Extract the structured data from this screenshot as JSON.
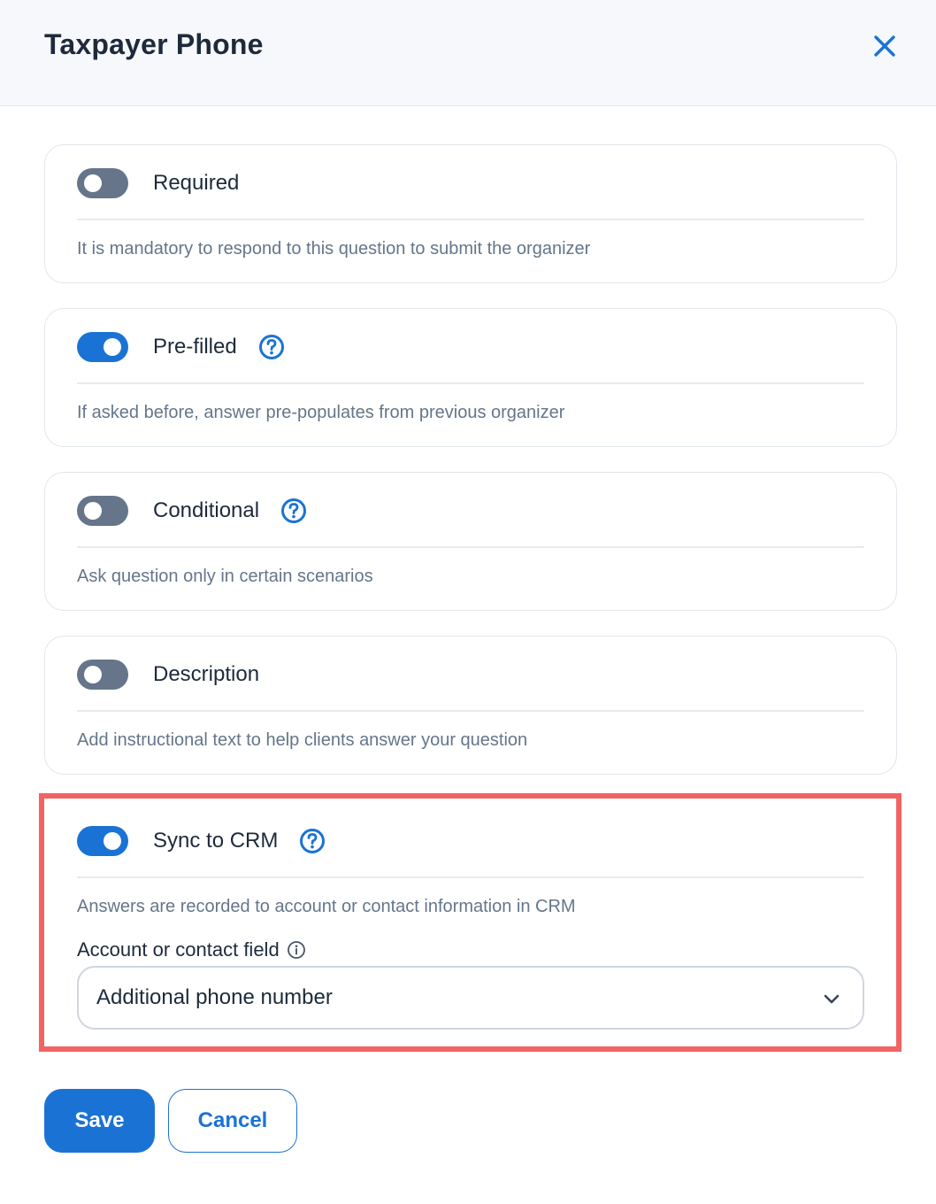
{
  "header": {
    "title": "Taxpayer Phone",
    "close_icon": "close-icon"
  },
  "settings": [
    {
      "label": "Required",
      "enabled": false,
      "has_help": false,
      "description": "It is mandatory to respond to this question to submit the organizer"
    },
    {
      "label": "Pre-filled",
      "enabled": true,
      "has_help": true,
      "description": "If asked before, answer pre-populates from previous organizer"
    },
    {
      "label": "Conditional",
      "enabled": false,
      "has_help": true,
      "description": "Ask question only in certain scenarios"
    },
    {
      "label": "Description",
      "enabled": false,
      "has_help": false,
      "description": "Add instructional text to help clients answer your question"
    }
  ],
  "sync": {
    "label": "Sync to CRM",
    "enabled": true,
    "has_help": true,
    "description": "Answers are recorded to account or contact information in CRM",
    "field_label": "Account or contact field",
    "field_value": "Additional phone number"
  },
  "actions": {
    "save_label": "Save",
    "cancel_label": "Cancel"
  },
  "colors": {
    "accent": "#1a73d4",
    "toggle_off": "#66758a",
    "highlight_border": "#f26363",
    "header_bg": "#f6f8fb"
  }
}
